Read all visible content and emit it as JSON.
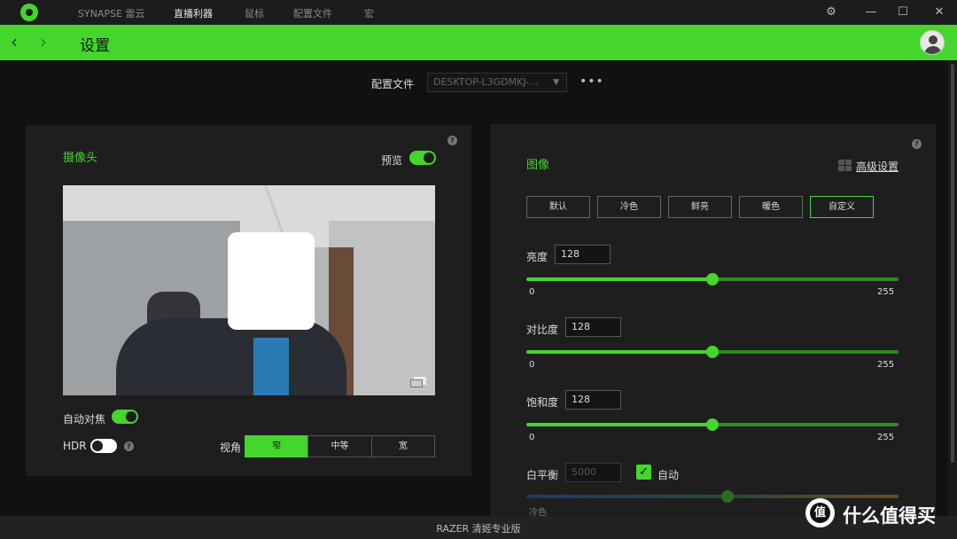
{
  "titlebar": {
    "nav": [
      "SYNAPSE 雷云",
      "直播利器",
      "鼠标",
      "配置文件",
      "宏"
    ],
    "active_index": 1
  },
  "header": {
    "title": "设置"
  },
  "profile": {
    "label": "配置文件",
    "value": "DESKTOP-L3GDMKJ-..."
  },
  "camera": {
    "title": "摄像头",
    "preview_label": "预览",
    "preview_on": true,
    "autofocus_label": "自动对焦",
    "autofocus_on": true,
    "hdr_label": "HDR",
    "hdr_on": false,
    "fov_label": "视角",
    "fov_options": [
      "窄",
      "中等",
      "宽"
    ],
    "fov_selected": "窄"
  },
  "image": {
    "title": "图像",
    "advanced_label": "高级设置",
    "presets": [
      "默认",
      "冷色",
      "鲜亮",
      "暖色",
      "自定义"
    ],
    "preset_selected": "自定义",
    "sliders": [
      {
        "label": "亮度",
        "value": "128",
        "min": "0",
        "max": "255",
        "fraction": 0.5
      },
      {
        "label": "对比度",
        "value": "128",
        "min": "0",
        "max": "255",
        "fraction": 0.5
      },
      {
        "label": "饱和度",
        "value": "128",
        "min": "0",
        "max": "255",
        "fraction": 0.5
      }
    ],
    "white_balance": {
      "label": "白平衡",
      "value": "5000",
      "auto_label": "自动",
      "auto_checked": true,
      "min_label": "冷色",
      "fraction": 0.54
    }
  },
  "footer": {
    "text": "RAZER 清姬专业版"
  },
  "watermark": {
    "logo_char": "值",
    "text": "什么值得买"
  },
  "colors": {
    "accent": "#44d62c",
    "bg": "#111111",
    "panel": "#1e1e1e"
  }
}
